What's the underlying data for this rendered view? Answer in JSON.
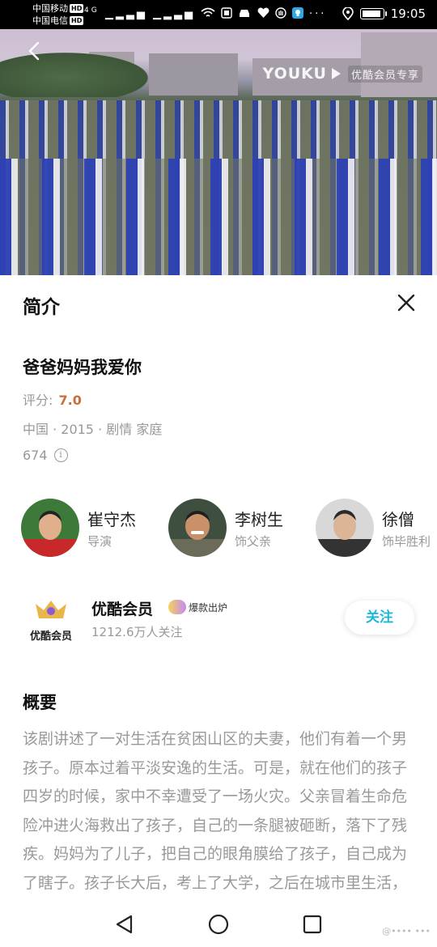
{
  "status_bar": {
    "carrier_1": "中国移动",
    "carrier_2": "中国电信",
    "hd_badge": "HD",
    "network": "4G",
    "signal_icons": "▁▂▃▅ ▁▂▃▅",
    "more_dots": "···",
    "time": "19:05",
    "battery_level": 0.9
  },
  "video": {
    "brand": "YOUKU",
    "vip_tag": "优酷会员专享"
  },
  "panel": {
    "header": "简介",
    "title": "爸爸妈妈我爱你",
    "rating_label": "评分:",
    "rating_value": "7.0",
    "meta": "中国 · 2015 · 剧情 家庭",
    "views": "674",
    "info_icon_glyph": "i"
  },
  "cast": [
    {
      "name": "崔守杰",
      "role": "导演"
    },
    {
      "name": "李树生",
      "role": "饰父亲"
    },
    {
      "name": "徐僧",
      "role": "饰毕胜利"
    }
  ],
  "channel": {
    "logo_label": "优酷会员",
    "name": "优酷会员",
    "badge": "爆款出炉",
    "followers": "1212.6万人关注",
    "follow_button": "关注"
  },
  "summary": {
    "title": "概要",
    "text": "该剧讲述了一对生活在贫困山区的夫妻，他们有着一个男孩子。原本过着平淡安逸的生活。可是，就在他们的孩子四岁的时候，家中不幸遭受了一场火灾。父亲冒着生命危险冲进火海救出了孩子，自己的一条腿被砸断，落下了残疾。妈妈为了儿子，把自己的眼角膜给了孩子，自己成为了瞎子。孩子长大后，考上了大学，之后在城市里生活，毕胜利的第一个女朋友就"
  },
  "watermark": "@•••• •••",
  "colors": {
    "accent": "#1fb7d8",
    "rating": "#c8703c",
    "muted": "#999999"
  }
}
